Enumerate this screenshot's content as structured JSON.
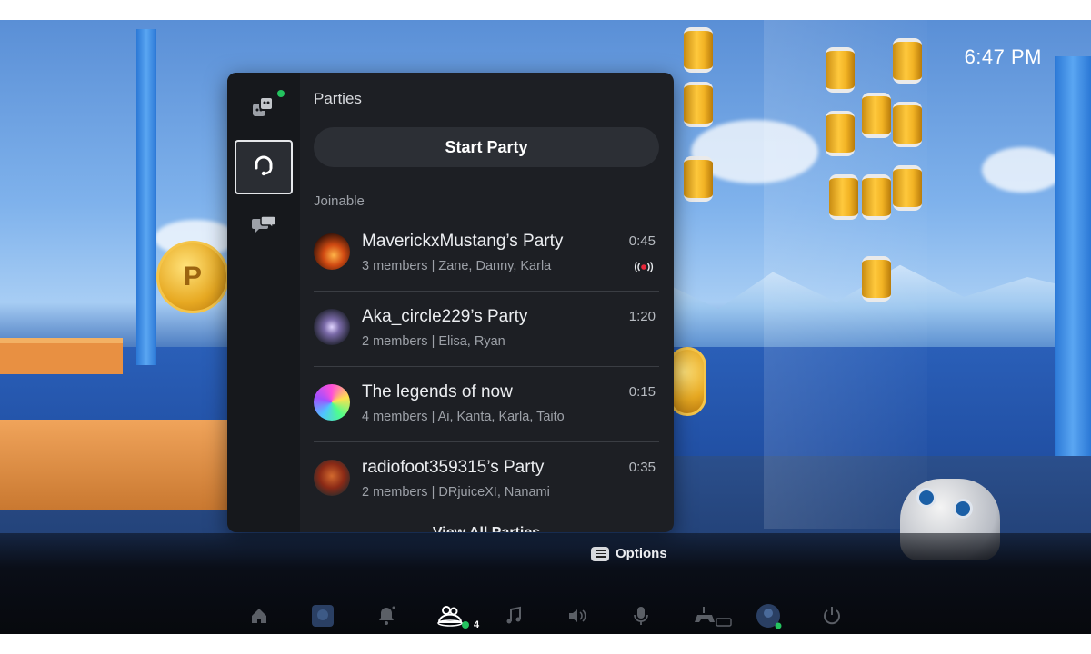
{
  "clock": {
    "time": "6:47 PM"
  },
  "panel": {
    "title": "Parties",
    "start_party_label": "Start Party",
    "section_label": "Joinable",
    "view_all_label": "View All Parties",
    "rail": [
      {
        "icon": "game-base-icon",
        "online": true
      },
      {
        "icon": "headset-icon",
        "selected": true
      },
      {
        "icon": "chat-bubbles-icon"
      }
    ],
    "parties": [
      {
        "name": "MaverickxMustang’s Party",
        "members": "3 members",
        "names": "Zane, Danny, Karla",
        "time": "0:45",
        "live": true,
        "avatar_color": "#c4491c"
      },
      {
        "name": "Aka_circle229’s Party",
        "members": "2 members",
        "names": "Elisa, Ryan",
        "time": "1:20",
        "live": false,
        "avatar_color": "#6a5a8c"
      },
      {
        "name": "The legends of now",
        "members": "4 members",
        "names": "Ai, Kanta, Karla, Taito",
        "time": "0:15",
        "live": false,
        "avatar_color": "#b25ad9"
      },
      {
        "name": "radiofoot359315’s Party",
        "members": "2 members",
        "names": "DRjuiceXI, Nanami",
        "time": "0:35",
        "live": false,
        "avatar_color": "#8b2a16"
      }
    ],
    "separator": "|"
  },
  "options_hint": {
    "label": "Options"
  },
  "control_center": {
    "party_count": "4",
    "icons": [
      "home-icon",
      "game-thumbnail-icon",
      "notifications-icon",
      "game-base-icon",
      "music-icon",
      "sound-icon",
      "mic-icon",
      "accessories-icon",
      "profile-avatar-icon",
      "power-icon"
    ]
  },
  "colors": {
    "online": "#24c35f",
    "live": "#e8273a",
    "panel_bg": "#1d1f24"
  }
}
